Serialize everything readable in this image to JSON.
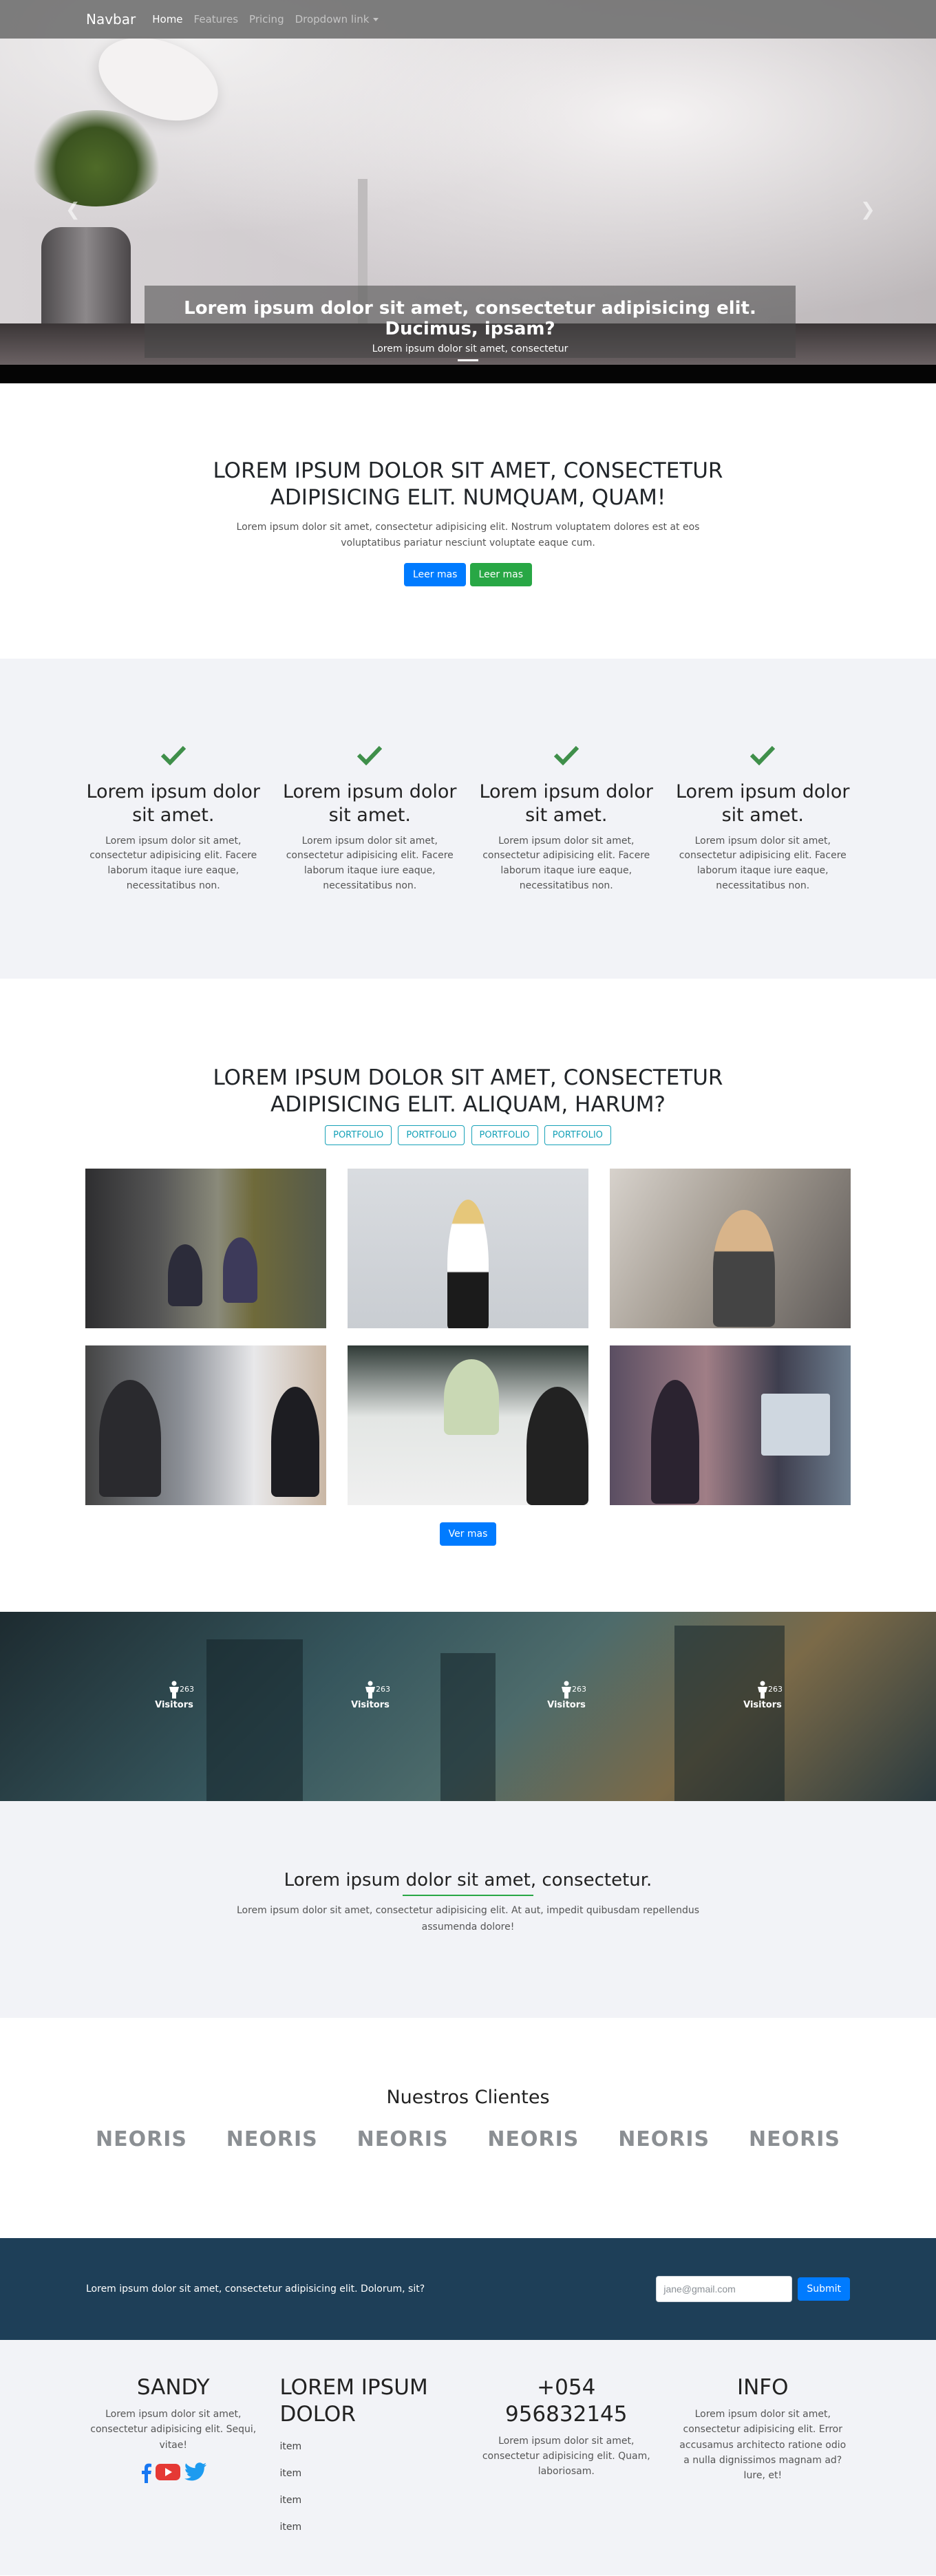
{
  "navbar": {
    "brand": "Navbar",
    "links": [
      "Home",
      "Features",
      "Pricing",
      "Dropdown link"
    ]
  },
  "hero": {
    "title": "Lorem ipsum dolor sit amet, consectetur adipisicing elit. Ducimus, ipsam?",
    "subtitle": "Lorem ipsum dolor sit amet, consectetur",
    "prev_icon": "chevron-left-icon",
    "next_icon": "chevron-right-icon"
  },
  "intro": {
    "title_line1": "LOREM IPSUM DOLOR SIT AMET, CONSECTETUR",
    "title_line2": "ADIPISICING ELIT. NUMQUAM, QUAM!",
    "text": "Lorem ipsum dolor sit amet, consectetur adipisicing elit. Nostrum voluptatem dolores est at eos voluptatibus pariatur nesciunt voluptate eaque cum.",
    "btn_primary": "Leer mas",
    "btn_success": "Leer mas"
  },
  "features": {
    "icon": "check-icon",
    "color": "#3f8f4a",
    "items": [
      {
        "title": "Lorem ipsum dolor sit amet.",
        "text": "Lorem ipsum dolor sit amet, consectetur adipisicing elit. Facere laborum itaque iure eaque, necessitatibus non."
      },
      {
        "title": "Lorem ipsum dolor sit amet.",
        "text": "Lorem ipsum dolor sit amet, consectetur adipisicing elit. Facere laborum itaque iure eaque, necessitatibus non."
      },
      {
        "title": "Lorem ipsum dolor sit amet.",
        "text": "Lorem ipsum dolor sit amet, consectetur adipisicing elit. Facere laborum itaque iure eaque, necessitatibus non."
      },
      {
        "title": "Lorem ipsum dolor sit amet.",
        "text": "Lorem ipsum dolor sit amet, consectetur adipisicing elit. Facere laborum itaque iure eaque, necessitatibus non."
      }
    ]
  },
  "portfolio": {
    "title_line1": "LOREM IPSUM DOLOR SIT AMET, CONSECTETUR",
    "title_line2": "ADIPISICING ELIT. ALIQUAM, HARUM?",
    "filters": [
      "PORTFOLIO",
      "PORTFOLIO",
      "PORTFOLIO",
      "PORTFOLIO"
    ],
    "more_button": "Ver mas"
  },
  "stats": {
    "icon": "person-icon",
    "items": [
      {
        "number": "263",
        "label": "Visitors"
      },
      {
        "number": "263",
        "label": "Visitors"
      },
      {
        "number": "263",
        "label": "Visitors"
      },
      {
        "number": "263",
        "label": "Visitors"
      }
    ]
  },
  "quote": {
    "title": "Lorem ipsum dolor sit amet, consectetur.",
    "text": "Lorem ipsum dolor sit amet, consectetur adipisicing elit. At aut, impedit quibusdam repellendus assumenda dolore!"
  },
  "clients": {
    "title": "Nuestros Clientes",
    "logos": [
      "NEORIS",
      "NEORIS",
      "NEORIS",
      "NEORIS",
      "NEORIS",
      "NEORIS"
    ]
  },
  "subscribe": {
    "text": "Lorem ipsum dolor sit amet, consectetur adipisicing elit. Dolorum, sit?",
    "placeholder": "jane@gmail.com",
    "button": "Submit"
  },
  "footer": {
    "col1": {
      "title": "SANDY",
      "text": "Lorem ipsum dolor sit amet, consectetur adipisicing elit. Sequi, vitae!",
      "social_icons": [
        "facebook-icon",
        "youtube-icon",
        "twitter-icon"
      ]
    },
    "col2": {
      "title_line1": "LOREM IPSUM",
      "title_line2": "DOLOR",
      "items": [
        "item",
        "item",
        "item",
        "item"
      ]
    },
    "col3": {
      "title": "+054 956832145",
      "text": "Lorem ipsum dolor sit amet, consectetur adipisicing elit. Quam, laboriosam."
    },
    "col4": {
      "title": "INFO",
      "text": "Lorem ipsum dolor sit amet, consectetur adipisicing elit. Error accusamus architecto ratione odio a nulla dignissimos magnam ad? Iure, et!"
    }
  }
}
